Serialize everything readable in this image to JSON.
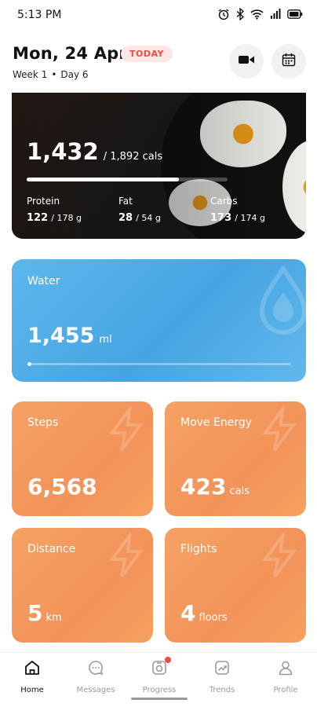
{
  "status_bar": {
    "time": "5:13 PM",
    "icons": [
      "alarm-icon",
      "bluetooth-icon",
      "wifi-icon",
      "signal-icon",
      "battery-icon"
    ]
  },
  "header": {
    "date": "Mon, 24 Apr",
    "badge": "TODAY",
    "week": "Week 1",
    "separator": "•",
    "day": "Day 6",
    "buttons": [
      "video-icon",
      "calendar-icon"
    ]
  },
  "calories": {
    "consumed": "1,432",
    "goal_text": "/ 1,892 cals",
    "progress_fraction": 0.757,
    "macros": [
      {
        "label": "Protein",
        "value": "122",
        "goal": "/ 178 g"
      },
      {
        "label": "Fat",
        "value": "28",
        "goal": "/ 54 g"
      },
      {
        "label": "Carbs",
        "value": "173",
        "goal": "/ 174 g"
      }
    ]
  },
  "water": {
    "label": "Water",
    "value": "1,455",
    "unit": "ml"
  },
  "tiles": {
    "steps": {
      "label": "Steps",
      "value": "6,568",
      "unit": ""
    },
    "move": {
      "label": "Move Energy",
      "value": "423",
      "unit": "cals"
    },
    "distance": {
      "label": "Distance",
      "value": "5",
      "unit": "km"
    },
    "flights": {
      "label": "Flights",
      "value": "4",
      "unit": "floors"
    }
  },
  "nav": {
    "items": [
      {
        "label": "Home",
        "icon": "home-icon",
        "active": true
      },
      {
        "label": "Messages",
        "icon": "messages-icon",
        "active": false
      },
      {
        "label": "Progress",
        "icon": "progress-icon",
        "active": false,
        "notification": true
      },
      {
        "label": "Trends",
        "icon": "trends-icon",
        "active": false
      },
      {
        "label": "Profile",
        "icon": "profile-icon",
        "active": false
      }
    ]
  },
  "colors": {
    "today_badge": "#ef4a3f",
    "water": "#4aa8e5",
    "tiles": "#f4985c",
    "notification_dot": "#ef4a3f"
  }
}
